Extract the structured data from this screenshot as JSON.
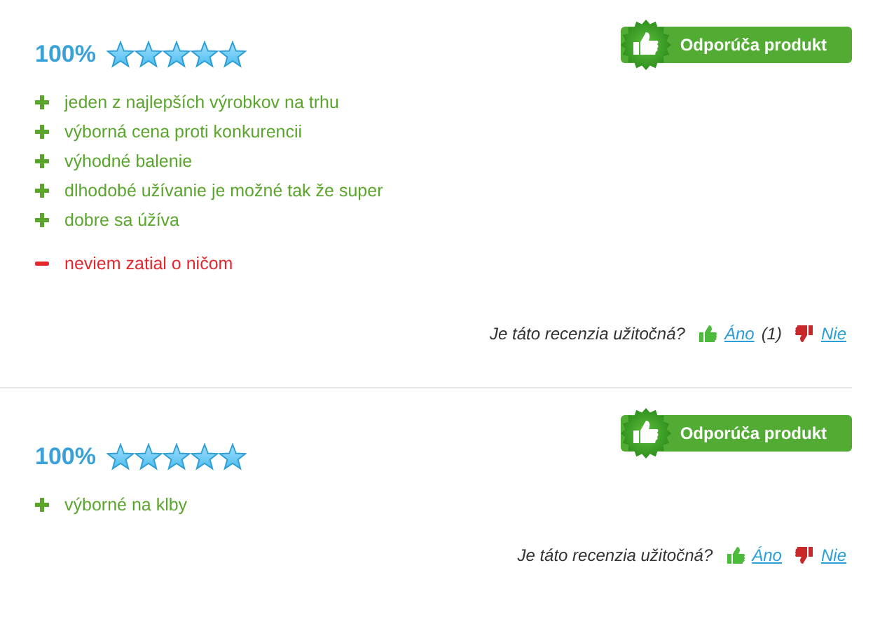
{
  "reviews": [
    {
      "rating": "100%",
      "stars": 5,
      "recommend": "Odporúča produkt",
      "points": [
        {
          "kind": "pro",
          "text": "jeden z najlepších výrobkov na trhu"
        },
        {
          "kind": "pro",
          "text": "výborná cena proti konkurencii"
        },
        {
          "kind": "pro",
          "text": "výhodné balenie"
        },
        {
          "kind": "pro",
          "text": "dlhodobé užívanie je možné tak že super"
        },
        {
          "kind": "pro",
          "text": "dobre sa úžíva"
        },
        {
          "kind": "con",
          "text": "neviem zatial o ničom"
        }
      ],
      "helpful": {
        "question": "Je táto recenzia užitočná?",
        "yes": "Áno",
        "yes_count": "(1)",
        "no": "Nie"
      }
    },
    {
      "rating": "100%",
      "stars": 5,
      "recommend": "Odporúča produkt",
      "points": [
        {
          "kind": "pro",
          "text": "výborné na klby"
        }
      ],
      "helpful": {
        "question": "Je táto recenzia užitočná?",
        "yes": "Áno",
        "no": "Nie"
      }
    }
  ]
}
